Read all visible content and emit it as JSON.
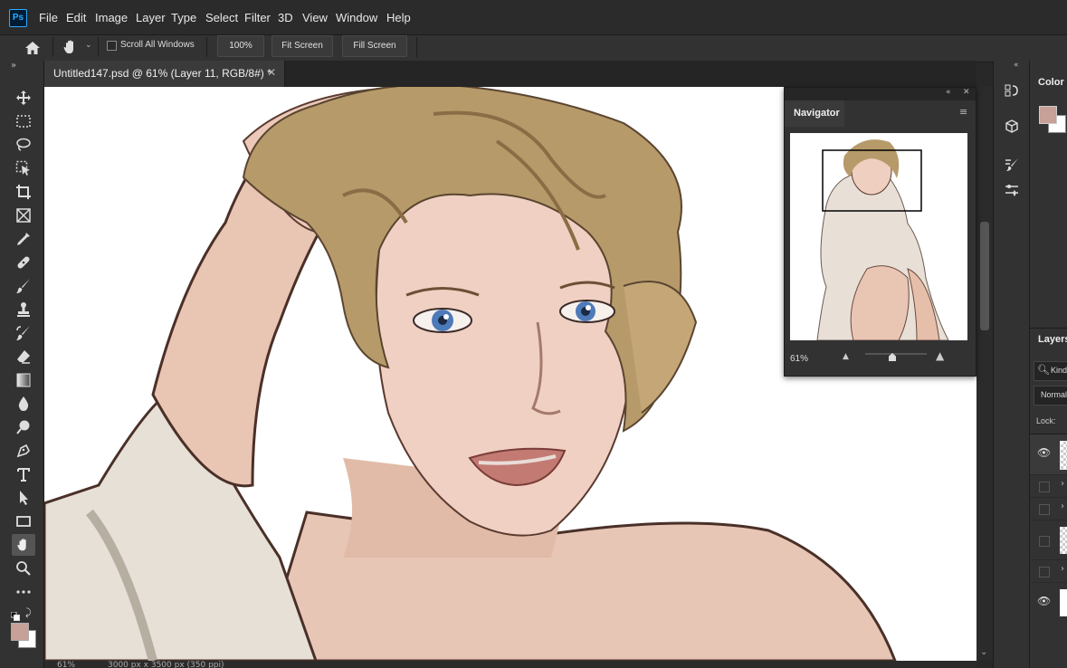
{
  "app": {
    "logo": "Ps"
  },
  "menu": [
    "File",
    "Edit",
    "Image",
    "Layer",
    "Type",
    "Select",
    "Filter",
    "3D",
    "View",
    "Window",
    "Help"
  ],
  "options": {
    "scroll_all_windows": "Scroll All Windows",
    "zoom_100": "100%",
    "fit_screen": "Fit Screen",
    "fill_screen": "Fill Screen"
  },
  "document": {
    "tab_title": "Untitled147.psd @ 61% (Layer 11, RGB/8#) *",
    "zoom": "61%"
  },
  "status": {
    "zoom": "61%",
    "dimensions": "3000 px x 3500 px (350 ppi)"
  },
  "navigator": {
    "title": "Navigator",
    "zoom": "61%"
  },
  "panels": {
    "color": "Color",
    "layers": "Layers",
    "search_placeholder": "Kind",
    "blend_mode": "Normal",
    "lock": "Lock:"
  },
  "colors": {
    "foreground": "#c7a097",
    "background": "#ffffff",
    "accent": "#31a8ff"
  },
  "tools": [
    "move-icon",
    "marquee-icon",
    "lasso-icon",
    "object-select-icon",
    "crop-icon",
    "frame-icon",
    "eyedropper-icon",
    "healing-icon",
    "brush-icon",
    "stamp-icon",
    "history-brush-icon",
    "eraser-icon",
    "gradient-icon",
    "blur-icon",
    "dodge-icon",
    "pen-icon",
    "type-icon",
    "path-select-icon",
    "rectangle-icon",
    "hand-icon",
    "zoom-icon",
    "more-icon"
  ]
}
